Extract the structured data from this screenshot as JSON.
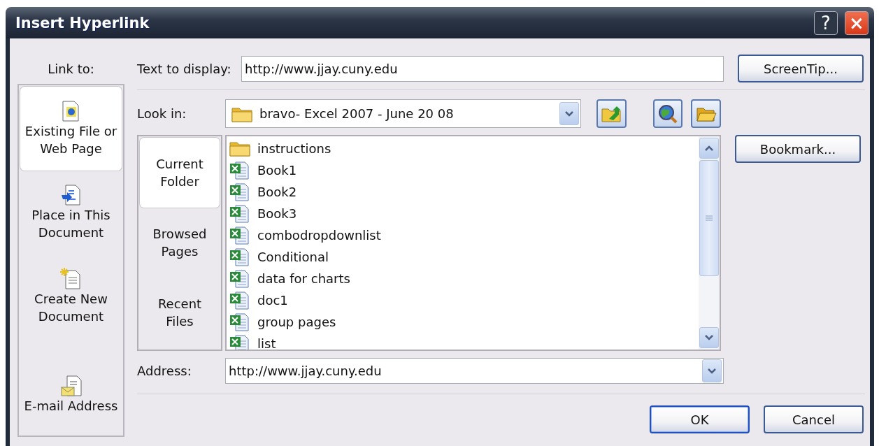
{
  "window": {
    "title": "Insert Hyperlink",
    "help_button": "?",
    "close_button": "×"
  },
  "link_to": {
    "label": "Link to:",
    "items": [
      {
        "label": "Existing File or Web Page",
        "kind": "web",
        "selected": true
      },
      {
        "label": "Place in This Document",
        "kind": "place",
        "selected": false
      },
      {
        "label": "Create New Document",
        "kind": "new",
        "selected": false
      },
      {
        "label": "E-mail Address",
        "kind": "email",
        "selected": false
      }
    ]
  },
  "text_to_display": {
    "label": "Text to display:",
    "value": "http://www.jjay.cuny.edu"
  },
  "screentip_button": "ScreenTip...",
  "look_in": {
    "label": "Look in:",
    "value": "bravo- Excel 2007 - June 20 08"
  },
  "view_tabs": [
    {
      "label": "Current Folder",
      "selected": true
    },
    {
      "label": "Browsed Pages",
      "selected": false
    },
    {
      "label": "Recent Files",
      "selected": false
    }
  ],
  "files": [
    {
      "name": "instructions",
      "kind": "folder"
    },
    {
      "name": "Book1",
      "kind": "workbook"
    },
    {
      "name": "Book2",
      "kind": "workbook"
    },
    {
      "name": "Book3",
      "kind": "workbook"
    },
    {
      "name": "combodropdownlist",
      "kind": "workbook"
    },
    {
      "name": "Conditional",
      "kind": "workbook"
    },
    {
      "name": "data for charts",
      "kind": "workbook"
    },
    {
      "name": "doc1",
      "kind": "workbook"
    },
    {
      "name": "group pages",
      "kind": "workbook"
    },
    {
      "name": "list",
      "kind": "workbook"
    }
  ],
  "bookmark_button": "Bookmark...",
  "address": {
    "label": "Address:",
    "value": "http://www.jjay.cuny.edu"
  },
  "buttons": [
    {
      "label": "OK",
      "default": true
    },
    {
      "label": "Cancel",
      "default": false
    }
  ]
}
